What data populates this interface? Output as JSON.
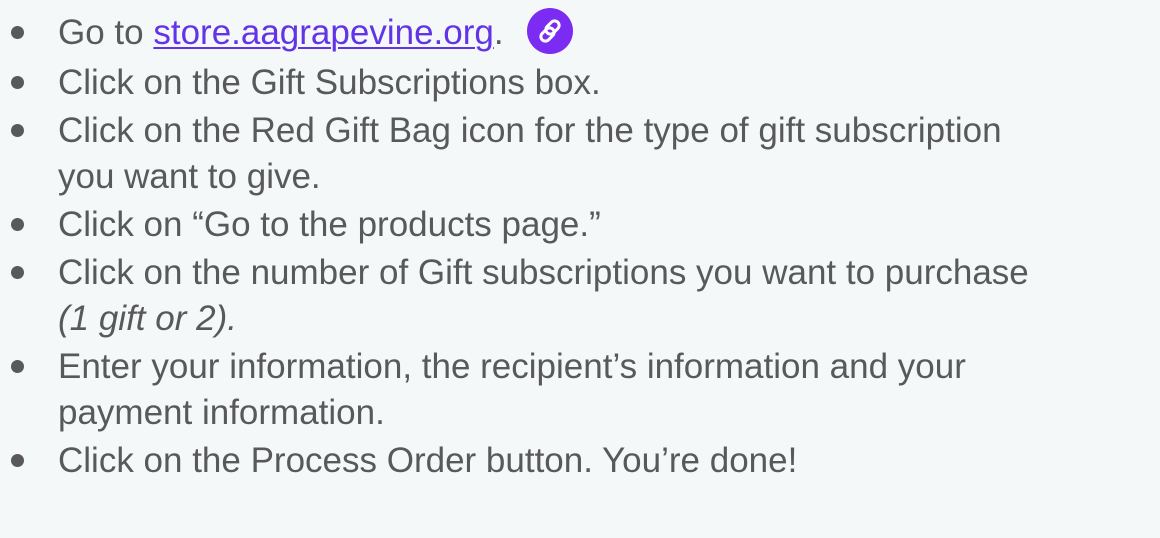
{
  "steps": [
    {
      "prefix": "Go to",
      "link_text": "store.aagrapevine.org",
      "suffix": ".",
      "icon": "link-icon"
    },
    {
      "text": "Click on the Gift Subscriptions box."
    },
    {
      "line1": "Click on the Red Gift Bag icon for the type of gift subscription",
      "line2": "you want to give."
    },
    {
      "text": "Click on “Go to the products page.”"
    },
    {
      "line1": "Click on the number of Gift subscriptions you want to purchase",
      "line2_italic": "(1 gift or 2)."
    },
    {
      "line1": "Enter your information, the recipient’s information and your",
      "line2": "payment information."
    },
    {
      "text": "Click on the Process Order button. You’re done!"
    }
  ],
  "colors": {
    "background": "#f4f8f9",
    "text": "#595959",
    "link": "#6234e6",
    "badge": "#7b2bf2"
  }
}
